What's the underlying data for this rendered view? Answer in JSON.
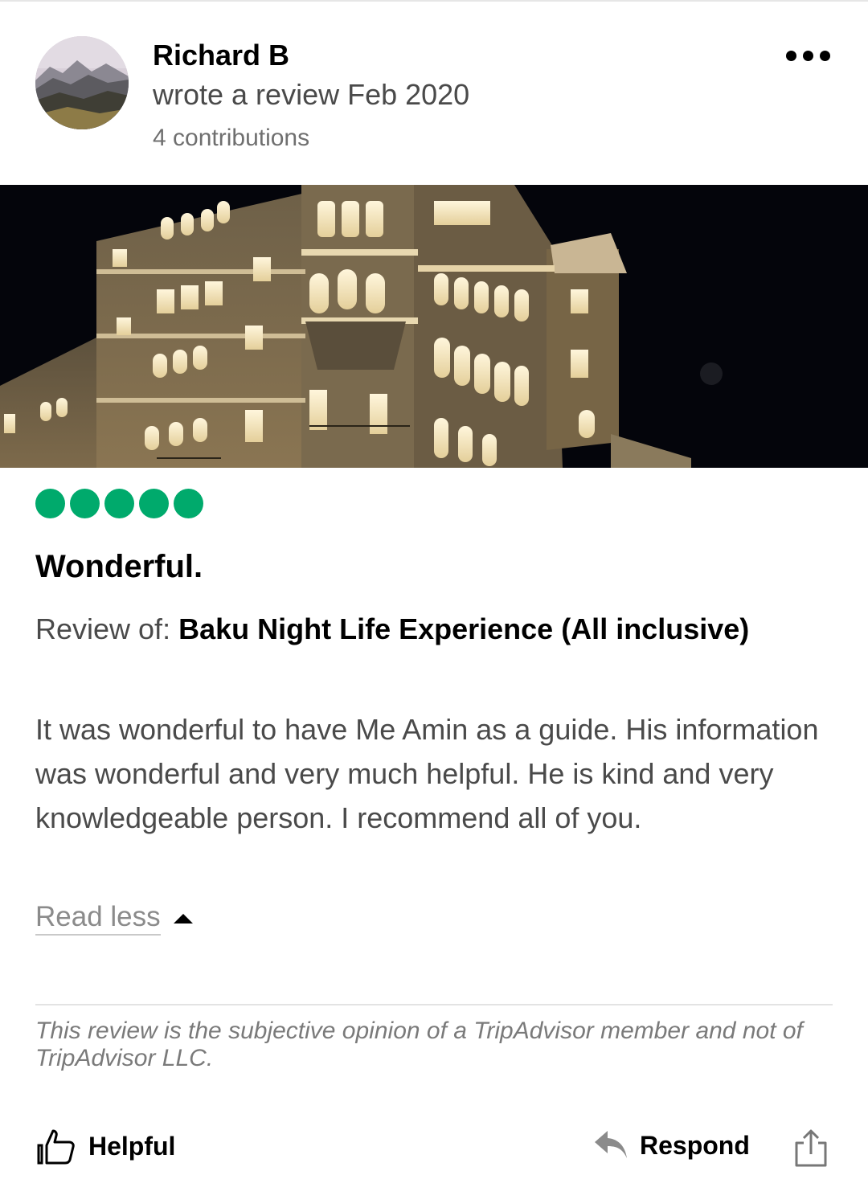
{
  "reviewer": {
    "name": "Richard B",
    "wrote_line": "wrote a review Feb 2020",
    "contributions": "4 contributions",
    "avatar_icon": "landscape-avatar"
  },
  "menu": {
    "icon": "more-horizontal-icon"
  },
  "photo": {
    "subject": "illuminated building at night"
  },
  "review": {
    "rating": 5,
    "rating_max": 5,
    "rating_color": "#00aa6c",
    "title": "Wonderful.",
    "review_of_prefix": "Review of: ",
    "review_of_name": "Baku Night Life Experience (All inclusive)",
    "body": "It was wonderful to have Me Amin as a guide. His information was wonderful and very much helpful. He is kind and very knowledgeable person. I recommend all of you.",
    "read_less": "Read less"
  },
  "disclaimer": "This review is the subjective opinion of a TripAdvisor member and not of TripAdvisor LLC.",
  "actions": {
    "helpful": "Helpful",
    "respond": "Respond",
    "helpful_icon": "thumbs-up-icon",
    "respond_icon": "reply-arrow-icon",
    "share_icon": "share-icon"
  }
}
